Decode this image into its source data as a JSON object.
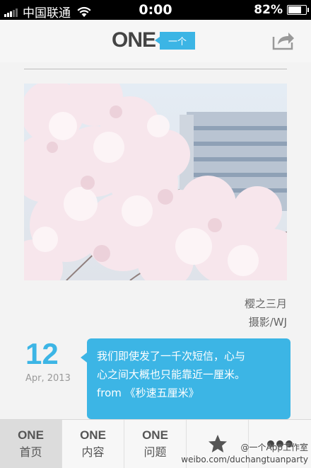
{
  "status_bar": {
    "carrier": "中国联通",
    "time": "0:00",
    "battery": "82%",
    "battery_level": 0.82
  },
  "header": {
    "logo_text": "ONE",
    "logo_tag": "一个",
    "share_icon": "share-icon"
  },
  "photo": {
    "title": "樱之三月",
    "author": "摄影/WJ"
  },
  "date": {
    "day": "12",
    "month_year": "Apr, 2013"
  },
  "quote": {
    "line1": "我们即使发了一千次短信，心与",
    "line2": "心之间大概也只能靠近一厘米。",
    "line3": "from 《秒速五厘米》"
  },
  "tabs": [
    {
      "line1": "ONE",
      "line2": "首页"
    },
    {
      "line1": "ONE",
      "line2": "内容"
    },
    {
      "line1": "ONE",
      "line2": "问题"
    },
    {
      "icon": "star-icon"
    },
    {
      "icon": "more-icon"
    }
  ],
  "watermark": {
    "line1": "@一个App工作室",
    "line2": "weibo.com/duchangtuanparty"
  },
  "colors": {
    "accent": "#3cb5e5",
    "status_bar": "#000000",
    "tab_active": "#dcdcdc"
  }
}
